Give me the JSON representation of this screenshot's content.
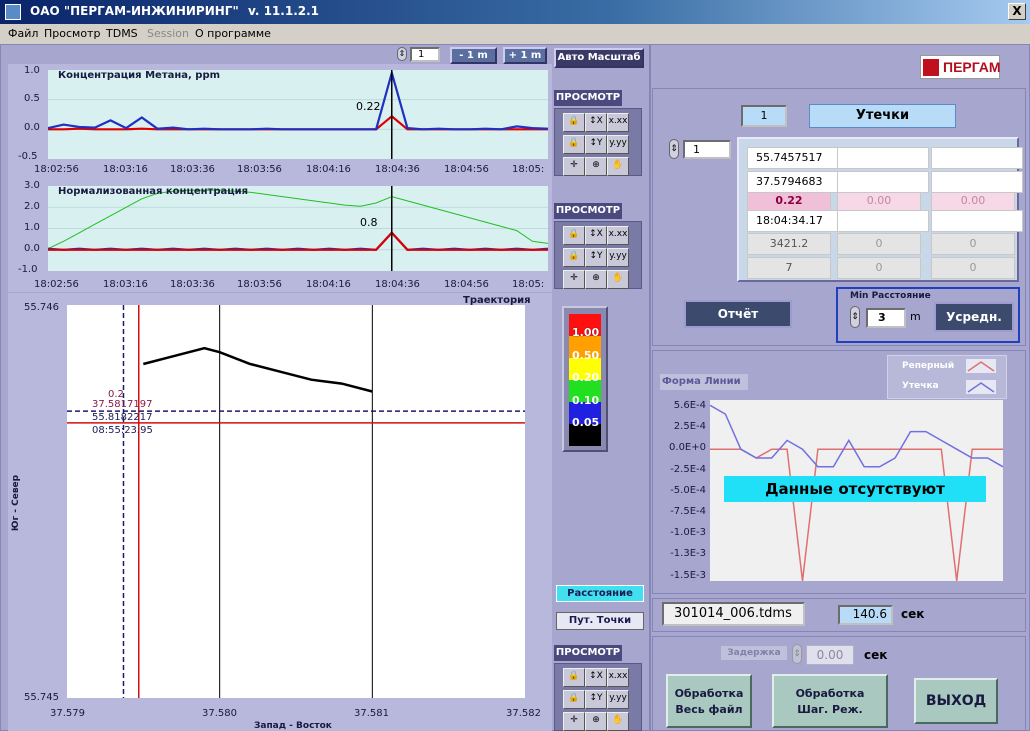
{
  "window": {
    "title": "ОАО \"ПЕРГАМ-ИНЖИНИРИНГ\"",
    "version": "v. 11.1.2.1",
    "close_glyph": "X"
  },
  "menu": [
    "Файл",
    "Просмотр",
    "TDMS",
    "Session",
    "О программе"
  ],
  "top_controls": {
    "step_value": "1",
    "minus_label": "- 1 m",
    "plus_label": "+ 1 m",
    "autoscale_label": "Авто Масштаб"
  },
  "chart_data": [
    {
      "type": "line",
      "title": "Концентрация Метана, ppm",
      "ylim": [
        -0.5,
        1.0
      ],
      "y_ticks": [
        "1.0",
        "0.5",
        "0.0",
        "-0.5"
      ],
      "x_ticks": [
        "18:02:56",
        "18:03:16",
        "18:03:36",
        "18:03:56",
        "18:04:16",
        "18:04:36",
        "18:04:56",
        "18:05:"
      ],
      "cursor_label": "0.22",
      "series": [
        {
          "color": "#dd0000",
          "values": [
            0.0,
            0.0,
            0.01,
            0.0,
            0.0,
            0.0,
            0.01,
            0.0,
            0.0,
            0.0,
            0.0,
            0.0,
            0.0,
            0.0,
            0.0,
            0.0,
            0.0,
            0.0,
            0.0,
            0.0,
            0.0,
            0.0,
            0.22,
            0.0,
            0.0,
            0.0,
            0.0,
            0.0,
            0.0,
            0.0,
            0.0,
            0.0,
            0.0
          ]
        },
        {
          "color": "#2030c0",
          "values": [
            0.02,
            0.08,
            0.04,
            0.03,
            0.15,
            0.02,
            0.2,
            0.01,
            0.03,
            0.0,
            0.01,
            0.0,
            0.0,
            0.0,
            0.01,
            0.0,
            0.0,
            0.0,
            0.0,
            0.0,
            0.0,
            0.0,
            0.95,
            0.02,
            0.0,
            0.01,
            0.0,
            0.0,
            0.01,
            0.0,
            0.05,
            0.02,
            0.01
          ]
        }
      ]
    },
    {
      "type": "line",
      "title": "Нормализованная концентрация",
      "ylim": [
        -1.0,
        3.0
      ],
      "y_ticks": [
        "3.0",
        "2.0",
        "1.0",
        "0.0",
        "-1.0"
      ],
      "x_ticks": [
        "18:02:56",
        "18:03:16",
        "18:03:36",
        "18:03:56",
        "18:04:16",
        "18:04:36",
        "18:04:56",
        "18:05:"
      ],
      "cursor_label": "0.8",
      "series": [
        {
          "color": "#20c020",
          "values": [
            0.05,
            0.4,
            0.8,
            1.2,
            1.6,
            2.0,
            2.4,
            2.65,
            2.75,
            2.8,
            2.8,
            2.8,
            2.75,
            2.7,
            2.6,
            2.5,
            2.4,
            2.3,
            2.2,
            2.1,
            2.05,
            2.2,
            2.5,
            2.3,
            2.1,
            1.9,
            1.7,
            1.5,
            1.3,
            1.1,
            0.9,
            0.4,
            0.3
          ]
        },
        {
          "color": "#2030c0",
          "values": [
            0.05,
            0.0,
            0.05,
            0.0,
            0.05,
            0.0,
            0.05,
            0.0,
            0.05,
            0.0,
            0.05,
            0.0,
            0.05,
            0.0,
            0.05,
            0.0,
            0.05,
            0.0,
            0.05,
            0.0,
            0.05,
            0.0,
            0.8,
            0.0,
            0.05,
            0.0,
            0.05,
            0.0,
            0.05,
            0.0,
            0.05,
            0.0,
            0.05
          ]
        },
        {
          "color": "#dd0000",
          "values": [
            0.0,
            0.0,
            0.0,
            0.0,
            0.0,
            0.0,
            0.0,
            0.0,
            0.0,
            0.0,
            0.0,
            0.0,
            0.0,
            0.0,
            0.0,
            0.0,
            0.0,
            0.0,
            0.0,
            0.0,
            0.0,
            0.0,
            0.8,
            0.0,
            0.0,
            0.0,
            0.0,
            0.0,
            0.0,
            0.0,
            0.0,
            0.0,
            0.0
          ]
        }
      ]
    },
    {
      "type": "line",
      "title": "Траектория",
      "xlabel": "Запад - Восток",
      "ylabel": "Юг - Север",
      "x_ticks": [
        "37.579",
        "37.580",
        "37.581",
        "37.582"
      ],
      "y_ticks": [
        "55.746",
        "55.745"
      ],
      "cursor_text": [
        "0.2",
        "37.5817197",
        "55.8182217",
        "08:55:23.95"
      ],
      "series": [
        {
          "color": "#000000",
          "x": [
            37.5795,
            37.5797,
            37.5799,
            37.58,
            37.5802,
            37.5804,
            37.5806,
            37.5808,
            37.581
          ],
          "y": [
            55.74585,
            55.74587,
            55.74589,
            55.74588,
            55.74585,
            55.74583,
            55.74581,
            55.7458,
            55.74578
          ]
        }
      ]
    },
    {
      "type": "line",
      "title": "Форма Линии",
      "y_ticks": [
        "5.6E-4",
        "2.5E-4",
        "0.0E+0",
        "-2.5E-4",
        "-5.0E-4",
        "-7.5E-4",
        "-1.0E-3",
        "-1.3E-3",
        "-1.5E-3"
      ],
      "legend": [
        "Реперный",
        "Утечка"
      ],
      "message": "Данные отсутствуют",
      "series": [
        {
          "name": "Реперный",
          "color": "#e07070",
          "values": [
            0.0,
            0.0,
            0.0,
            -0.0001,
            0.0,
            0.0,
            -0.0015,
            0.0,
            0.0,
            0.0,
            0.0,
            0.0,
            0.0,
            0.0,
            0.0,
            0.0,
            -0.0015,
            0.0,
            0.0,
            0.0
          ]
        },
        {
          "name": "Утечка",
          "color": "#7070e0",
          "values": [
            0.0005,
            0.0004,
            0.0,
            -0.0001,
            -0.0001,
            0.0001,
            0.0,
            -0.0002,
            -0.0002,
            0.0001,
            -0.0002,
            -0.0002,
            -0.0001,
            0.0002,
            0.0002,
            0.0001,
            0.0,
            -0.0001,
            -0.0001,
            -0.0002
          ]
        }
      ]
    }
  ],
  "toolbox": {
    "prosmotr_label": "ПРОСМОТР"
  },
  "colorscale": [
    "1.00",
    "0.50",
    "0.20",
    "0.10",
    "0.05"
  ],
  "colorscale_colors": [
    "#ff1010",
    "#ffa000",
    "#ffff00",
    "#20e020",
    "#2020e0",
    "#000000"
  ],
  "mode_buttons": {
    "distance": "Расстояние",
    "waypoints": "Пут. Точки"
  },
  "logo": "ПЕРГАМ",
  "leak": {
    "index": "1",
    "title": "Утечки",
    "selector": "1",
    "col1": [
      "55.7457517",
      "37.5794683",
      "0.22",
      "18:04:34.17",
      "3421.2",
      "7"
    ],
    "col2": [
      "",
      "",
      "0.00",
      "",
      "0",
      "0"
    ],
    "col3": [
      "",
      "",
      "0.00",
      "",
      "0",
      "0"
    ]
  },
  "report_label": "Отчёт",
  "min_distance": {
    "label": "Min Расстояние",
    "value": "3",
    "unit": "m",
    "average_label": "Усредн."
  },
  "file": {
    "name": "301014_006.tdms",
    "seconds": "140.6",
    "unit": "сек"
  },
  "delay": {
    "label": "Задержка",
    "value": "0.00",
    "unit": "сек"
  },
  "actions": {
    "process_file": [
      "Обработка",
      "Весь файл"
    ],
    "process_step": [
      "Обработка",
      "Шаг. Реж."
    ],
    "exit": "ВЫХОД"
  }
}
